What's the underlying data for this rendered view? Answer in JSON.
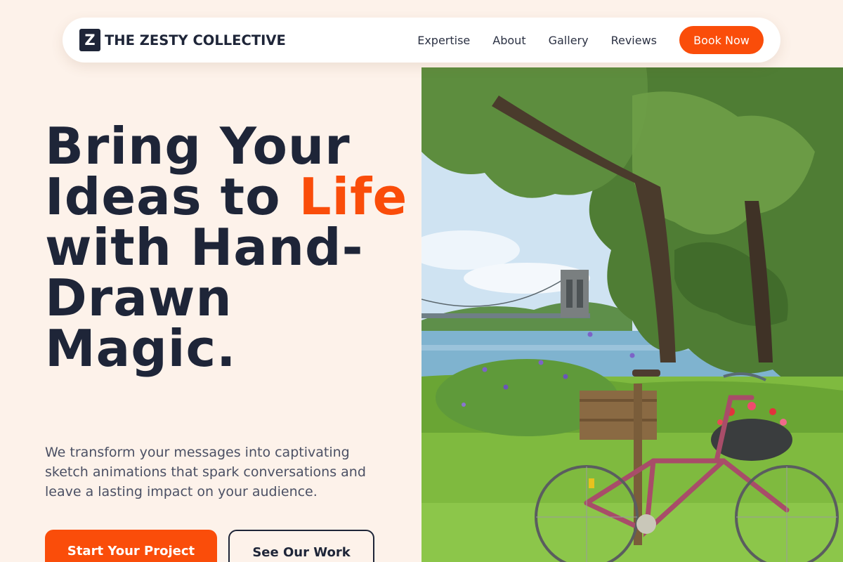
{
  "brand": {
    "logo_letter": "Z",
    "name": "THE ZESTY COLLECTIVE"
  },
  "nav": {
    "links": [
      "Expertise",
      "About",
      "Gallery",
      "Reviews"
    ],
    "cta_label": "Book Now"
  },
  "hero": {
    "headline_part1": "Bring Your Ideas to ",
    "headline_accent": "Life",
    "headline_part2": " with Hand-Drawn Magic.",
    "subcopy": "We transform your messages into captivating sketch animations that spark conversations and leave a lasting impact on your audience.",
    "primary_cta": "Start Your Project",
    "secondary_cta": "See Our Work"
  },
  "colors": {
    "accent": "#fa4d0a",
    "ink": "#1e2538",
    "background": "#fdf2ea"
  }
}
